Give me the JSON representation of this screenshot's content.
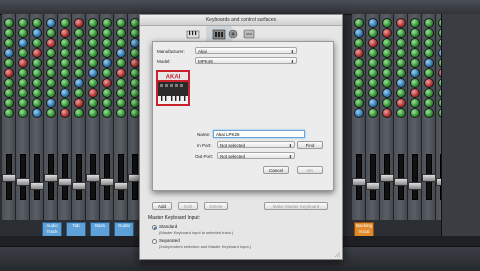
{
  "dialog": {
    "title": "Keyboards and control surfaces",
    "toolbar": [
      {
        "label": "",
        "icon": "keyboard-icon"
      },
      {
        "label": "",
        "icon": "controller-icon"
      },
      {
        "label": "",
        "icon": "record-icon"
      },
      {
        "label": "",
        "icon": "sync-icon"
      }
    ],
    "sheet": {
      "manufacturer_label": "Manufacturer:",
      "manufacturer_value": "Akai",
      "model_label": "Model:",
      "model_value": "MPK49",
      "name_label": "Name:",
      "name_value": "Akai LPK25",
      "in_port_label": "In Port:",
      "in_port_value": "Not selected",
      "find_label": "Find",
      "out_port_label": "Out Port:",
      "out_port_value": "Not selected",
      "cancel_label": "Cancel",
      "ok_label": "OK"
    },
    "buttons": {
      "add": "Add",
      "edit": "Edit",
      "delete": "Delete",
      "make_master": "Make Master Keyboard"
    },
    "master_input": {
      "heading": "Master Keyboard Input:",
      "standard_label": "Standard",
      "standard_desc": "(Master Keyboard input to selected track.)",
      "separated_label": "Separated",
      "separated_desc": "(Independent selection and Master Keyboard input.)"
    }
  },
  "mixer": {
    "channel_labels": [
      "Audio Track",
      "Tab",
      "Bass",
      "Guitar",
      "Backing Vocal"
    ]
  },
  "colors": {
    "accent_blue": "#5da1d8",
    "accent_orange": "#e08a2a",
    "focus_ring": "#6aa4d8"
  }
}
